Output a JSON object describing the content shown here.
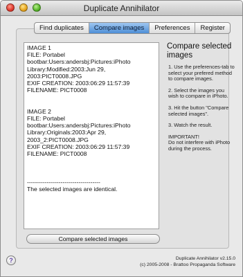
{
  "window": {
    "title": "Duplicate Annihilator"
  },
  "tabs": [
    {
      "label": "Find duplicates",
      "active": false
    },
    {
      "label": "Compare images",
      "active": true
    },
    {
      "label": "Preferences",
      "active": false
    },
    {
      "label": "Register",
      "active": false
    }
  ],
  "result_text": {
    "image1": [
      "IMAGE 1",
      "FILE: Portabel",
      "bootbar:Users:andersbj:Pictures:iPhoto",
      "Library:Modified:2003:Jun 29,",
      "2003:PICT0008.JPG",
      "EXIF CREATION: 2003:06:29 11:57:39",
      "FILENAME: PICT0008"
    ],
    "image2": [
      "IMAGE 2",
      "FILE: Portabel",
      "bootbar:Users:andersbj:Pictures:iPhoto",
      "Library:Originals:2003:Apr 29,",
      "2003_2:PICT0008.JPG",
      "EXIF CREATION: 2003:06:29 11:57:39",
      "FILENAME: PICT0008"
    ],
    "separator": "-------------------------------------",
    "result": "The selected images are identical."
  },
  "sidebar": {
    "title": "Compare selected images",
    "steps": [
      "1. Use the preferences-tab to select your prefered method to compare images.",
      "2. Select the images you wish to compare in iPhoto.",
      "3. Hit the button \"Compare selected images\".",
      "3. Watch the result."
    ],
    "important_heading": "IMPORTANT!",
    "important_text": "Do not interfere with iPhoto during the process."
  },
  "buttons": {
    "compare": "Compare selected images",
    "help": "?"
  },
  "footer": {
    "version": "Duplicate Annihilator v2.15.0",
    "copyright": "(c) 2005-2008 - Brattoo Propaganda Software"
  },
  "colors": {
    "active_tab": "#5b98dc",
    "close": "#e0392e",
    "minimize": "#e6a51d",
    "zoom": "#56b629"
  }
}
